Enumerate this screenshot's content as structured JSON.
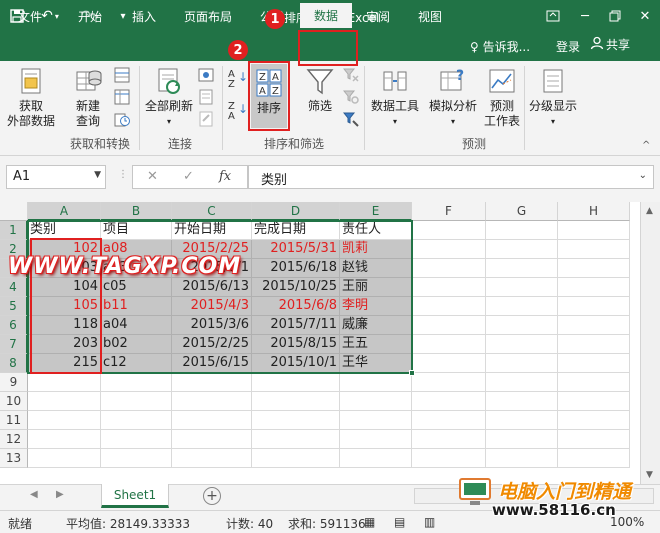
{
  "titlebar": {
    "title": "排序.xlsx - Excel",
    "icons": [
      "save-icon",
      "undo-icon",
      "redo-icon",
      "customize-qat-icon",
      "ribbon-display-icon",
      "minimize-icon",
      "restore-icon",
      "close-icon"
    ]
  },
  "tabs": [
    {
      "label": "文件"
    },
    {
      "label": "开始"
    },
    {
      "label": "插入"
    },
    {
      "label": "页面布局"
    },
    {
      "label": "公式"
    },
    {
      "label": "数据"
    },
    {
      "label": "审阅"
    },
    {
      "label": "视图"
    }
  ],
  "tellme": "♀ 告诉我...",
  "login": "登录",
  "share": "共享",
  "ribbon": {
    "get_external": [
      "获取",
      "外部数据"
    ],
    "new_query": [
      "新建",
      "查询"
    ],
    "refresh_all": "全部刷新",
    "sort": "排序",
    "filter": "筛选",
    "data_tools": "数据工具",
    "what_if": "模拟分析",
    "forecast": [
      "预测",
      "工作表"
    ],
    "outline": "分级显示",
    "groups": {
      "get_transform": "获取和转换",
      "connections": "连接",
      "sort_filter": "排序和筛选",
      "forecast": "预测"
    }
  },
  "badges": [
    "1",
    "2"
  ],
  "formula": {
    "namebox": "A1",
    "fx": "fx",
    "content": "类别"
  },
  "grid": {
    "columns": [
      "A",
      "B",
      "C",
      "D",
      "E",
      "F",
      "G",
      "H"
    ],
    "rows": [
      "1",
      "2",
      "3",
      "4",
      "5",
      "6",
      "7",
      "8",
      "9",
      "10",
      "11",
      "12",
      "13"
    ],
    "data": [
      [
        "类别",
        "项目",
        "开始日期",
        "完成日期",
        "责任人"
      ],
      [
        "102",
        "a08",
        "2015/2/25",
        "2015/5/31",
        "凯莉"
      ],
      [
        "103",
        "a03",
        "2015/3/1",
        "2015/6/18",
        "赵钱"
      ],
      [
        "104",
        "c05",
        "2015/6/13",
        "2015/10/25",
        "王丽"
      ],
      [
        "105",
        "b11",
        "2015/4/3",
        "2015/6/8",
        "李明"
      ],
      [
        "118",
        "a04",
        "2015/3/6",
        "2015/7/11",
        "威廉"
      ],
      [
        "203",
        "b02",
        "2015/2/25",
        "2015/8/15",
        "王五"
      ],
      [
        "215",
        "c12",
        "2015/6/15",
        "2015/10/1",
        "王华"
      ]
    ],
    "red_rows": [
      1,
      4
    ]
  },
  "sheet_tab": "Sheet1",
  "add_sheet": "+",
  "status": {
    "ready": "就绪",
    "average": "平均值: 28149.33333",
    "count": "计数: 40",
    "sum": "求和: 591136",
    "zoom": "100%"
  },
  "watermarks": {
    "site1": "WWW.TAGXP.COM",
    "site2_cn": "电脑入门到精通",
    "site2_url": "www.58116.cn"
  },
  "colors": {
    "excel_green": "#217346",
    "highlight_red": "#e02020"
  }
}
